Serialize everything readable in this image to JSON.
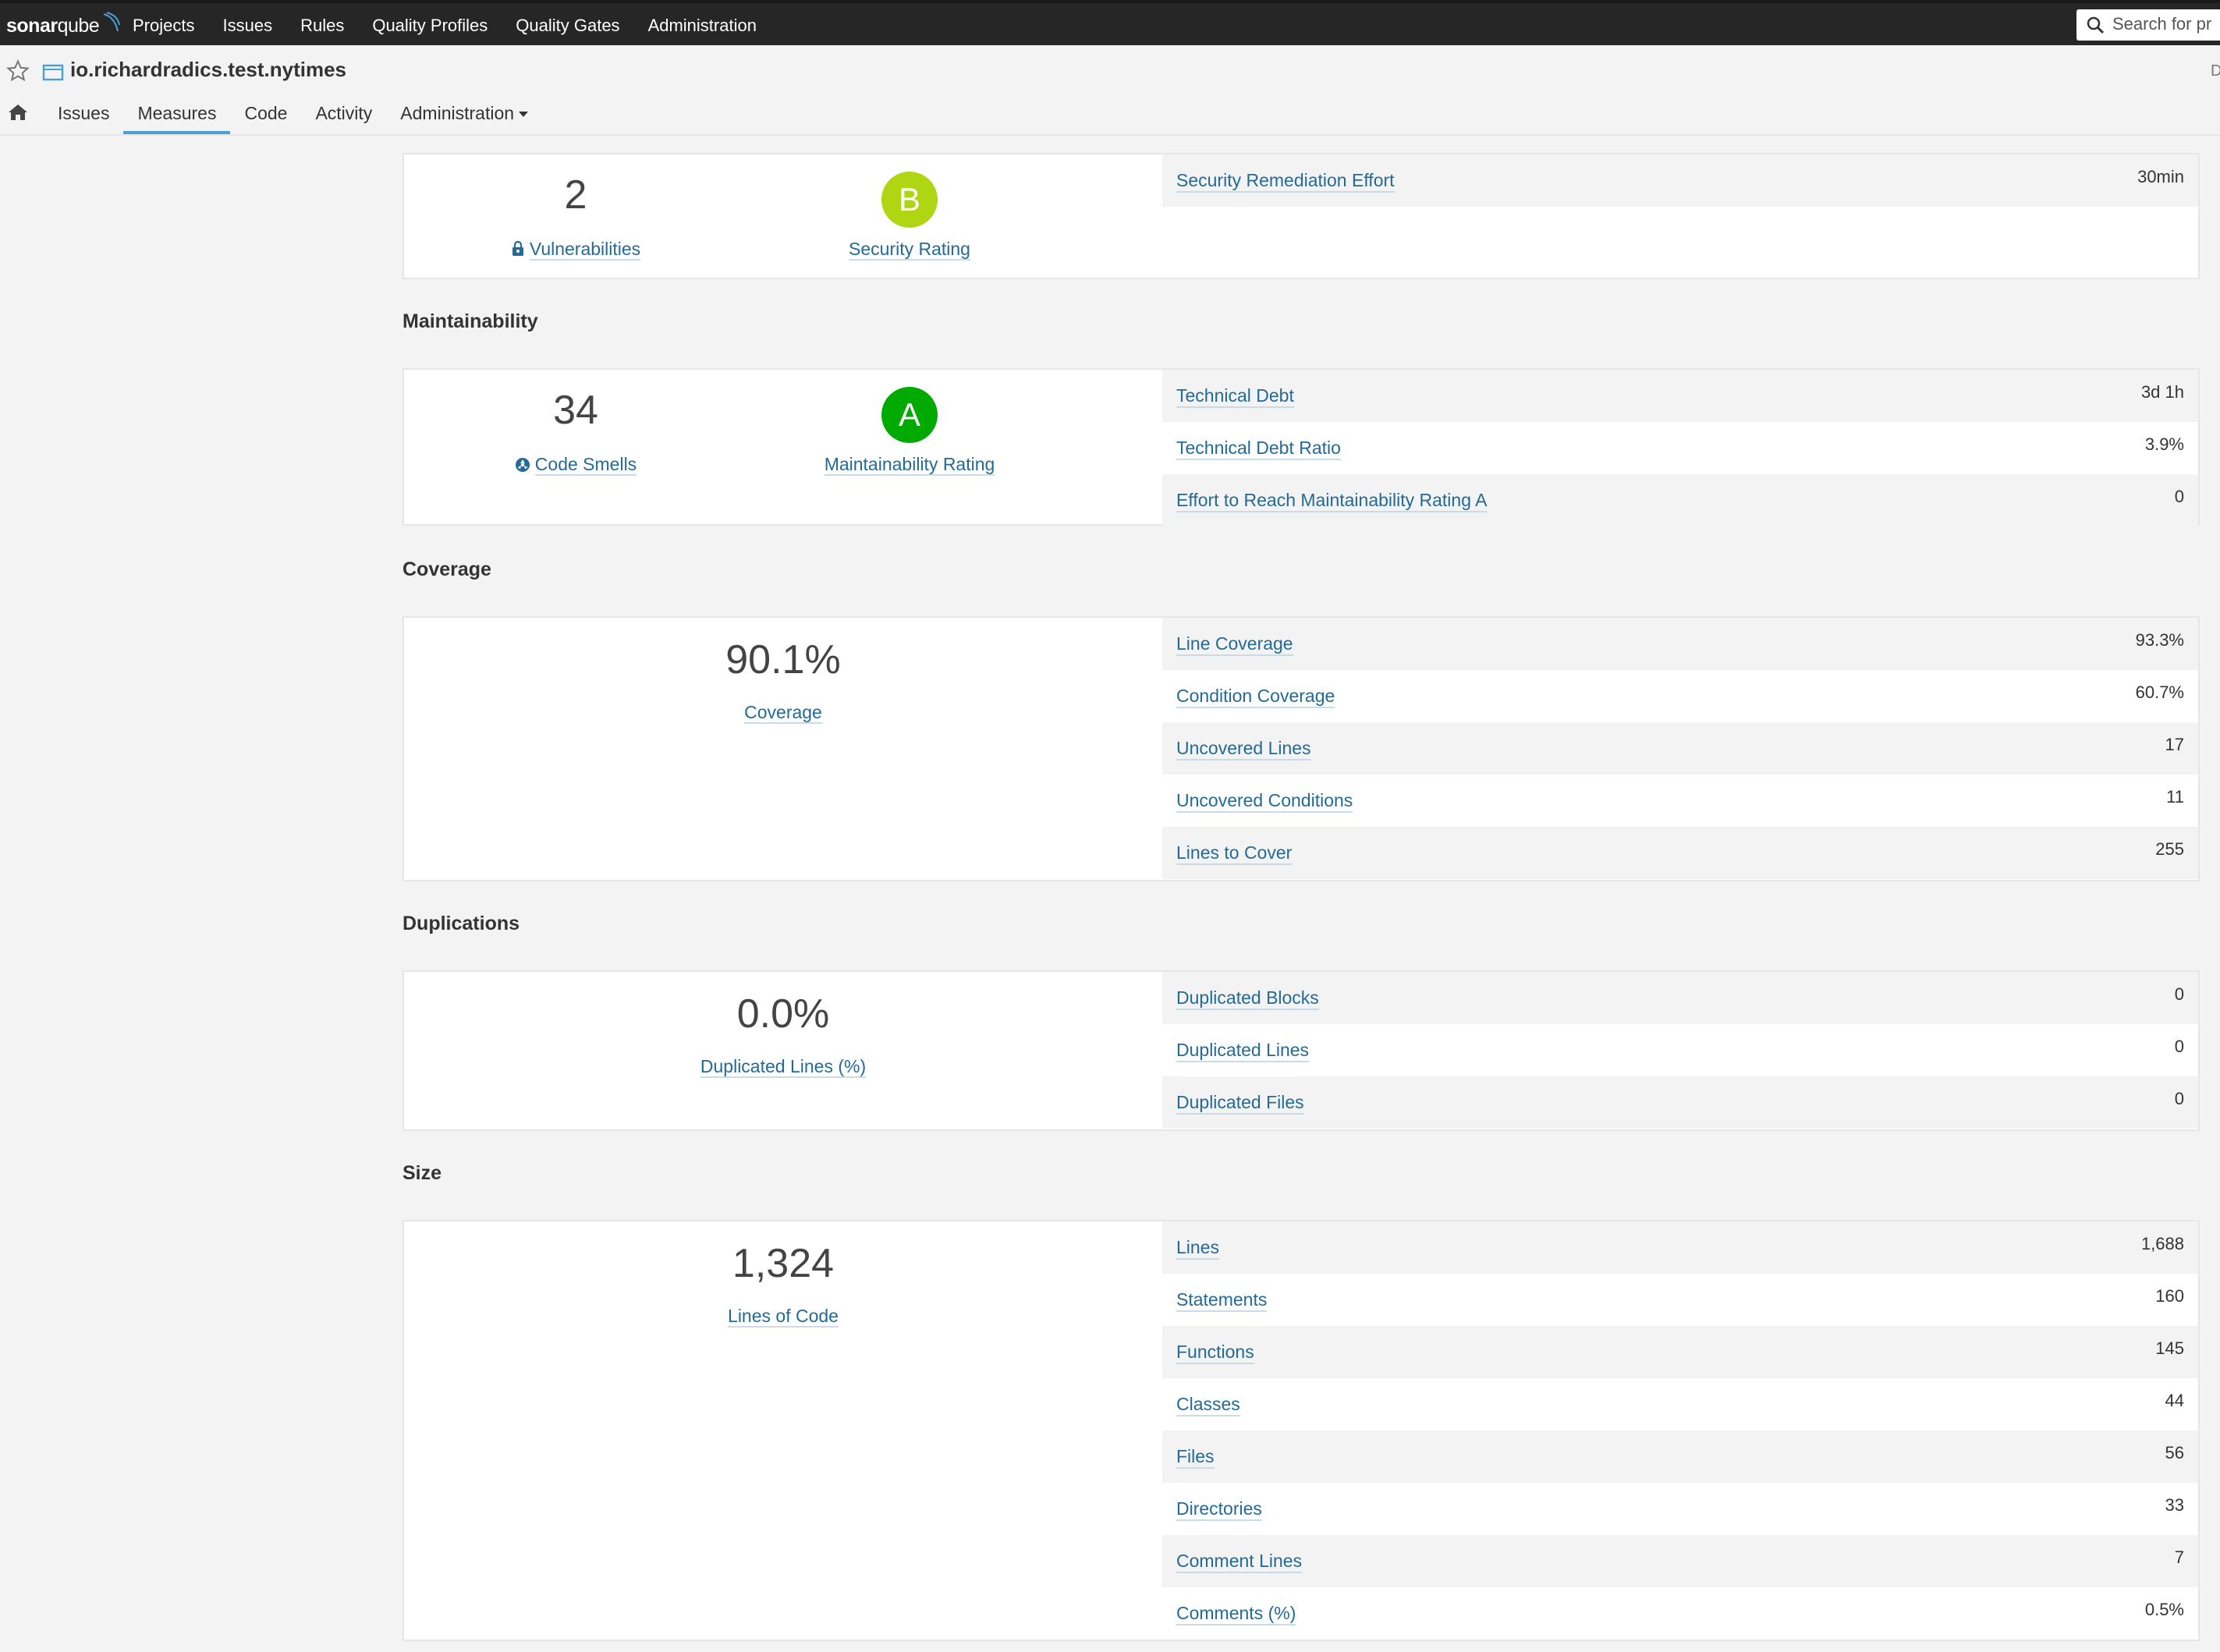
{
  "global_nav": {
    "logo_text_bold": "sonar",
    "logo_text_thin": "qube",
    "menu": [
      "Projects",
      "Issues",
      "Rules",
      "Quality Profiles",
      "Quality Gates",
      "Administration"
    ],
    "search_placeholder": "Search for pr"
  },
  "component": {
    "name": "io.richardradics.test.nytimes",
    "right_edge_text": "D",
    "tabs": [
      "Issues",
      "Measures",
      "Code",
      "Activity",
      "Administration"
    ],
    "active_tab": "Measures"
  },
  "security": {
    "vulnerabilities_value": "2",
    "vulnerabilities_label": "Vulnerabilities",
    "rating_letter": "B",
    "rating_label": "Security Rating",
    "rating_color": "#b0d513",
    "rows": [
      {
        "label": "Security Remediation Effort",
        "value": "30min"
      }
    ]
  },
  "maintainability": {
    "title": "Maintainability",
    "code_smells_value": "34",
    "code_smells_label": "Code Smells",
    "rating_letter": "A",
    "rating_label": "Maintainability Rating",
    "rating_color": "#00aa00",
    "rows": [
      {
        "label": "Technical Debt",
        "value": "3d 1h"
      },
      {
        "label": "Technical Debt Ratio",
        "value": "3.9%"
      },
      {
        "label": "Effort to Reach Maintainability Rating A",
        "value": "0"
      }
    ]
  },
  "coverage": {
    "title": "Coverage",
    "big_value": "90.1%",
    "big_label": "Coverage",
    "rows": [
      {
        "label": "Line Coverage",
        "value": "93.3%"
      },
      {
        "label": "Condition Coverage",
        "value": "60.7%"
      },
      {
        "label": "Uncovered Lines",
        "value": "17"
      },
      {
        "label": "Uncovered Conditions",
        "value": "11"
      },
      {
        "label": "Lines to Cover",
        "value": "255"
      }
    ]
  },
  "duplications": {
    "title": "Duplications",
    "big_value": "0.0%",
    "big_label": "Duplicated Lines (%)",
    "rows": [
      {
        "label": "Duplicated Blocks",
        "value": "0"
      },
      {
        "label": "Duplicated Lines",
        "value": "0"
      },
      {
        "label": "Duplicated Files",
        "value": "0"
      }
    ]
  },
  "size": {
    "title": "Size",
    "big_value": "1,324",
    "big_label": "Lines of Code",
    "rows": [
      {
        "label": "Lines",
        "value": "1,688"
      },
      {
        "label": "Statements",
        "value": "160"
      },
      {
        "label": "Functions",
        "value": "145"
      },
      {
        "label": "Classes",
        "value": "44"
      },
      {
        "label": "Files",
        "value": "56"
      },
      {
        "label": "Directories",
        "value": "33"
      },
      {
        "label": "Comment Lines",
        "value": "7"
      },
      {
        "label": "Comments (%)",
        "value": "0.5%"
      }
    ]
  }
}
